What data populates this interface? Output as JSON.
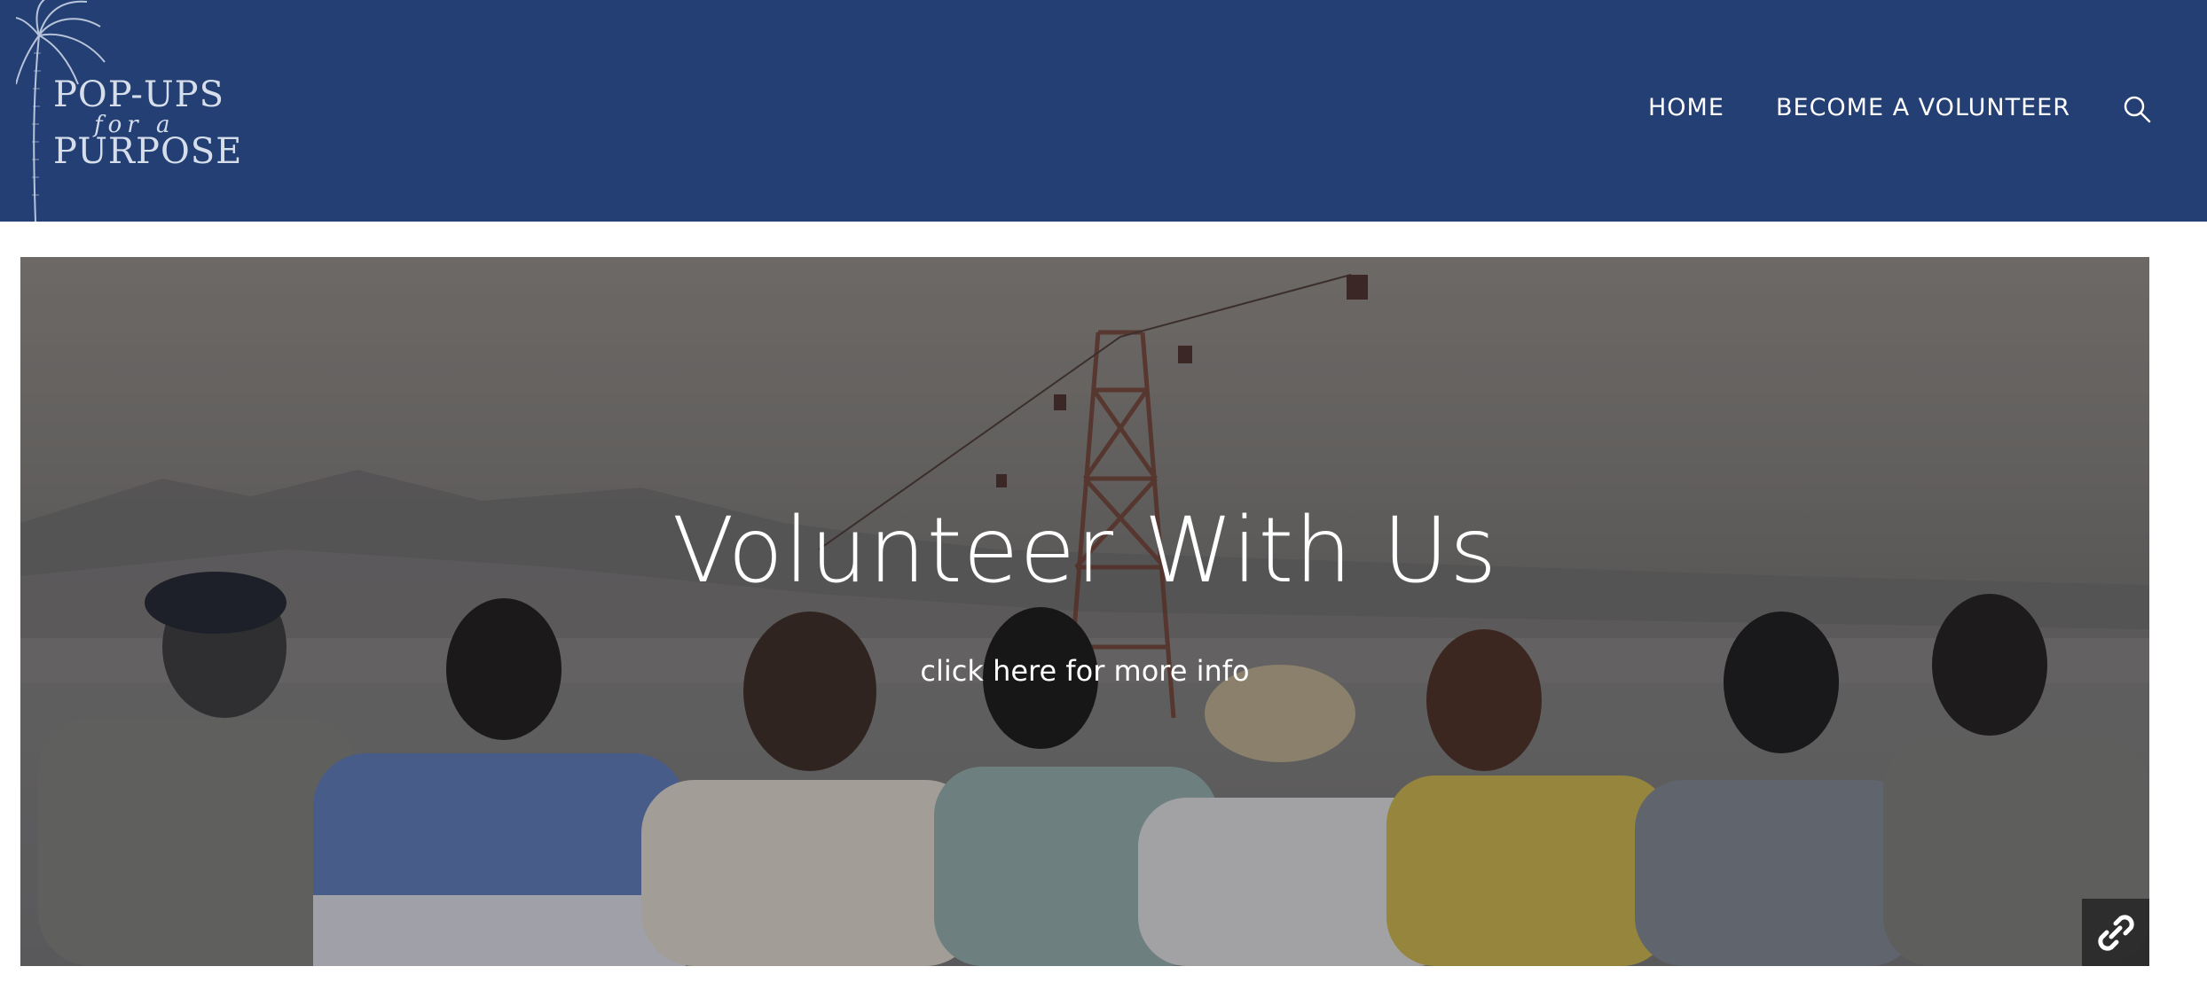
{
  "header": {
    "logo": {
      "line1": "POP-UPS",
      "line2": "for a",
      "line3": "PURPOSE",
      "icon": "palm-tree-icon"
    },
    "nav": {
      "home_label": "HOME",
      "volunteer_label": "BECOME A VOLUNTEER",
      "search_icon": "search-icon"
    },
    "colors": {
      "background": "#243f73",
      "text": "#ffffff"
    }
  },
  "hero": {
    "title": "Volunteer With Us",
    "link_text": "click here for more info",
    "link_icon": "link-icon"
  }
}
